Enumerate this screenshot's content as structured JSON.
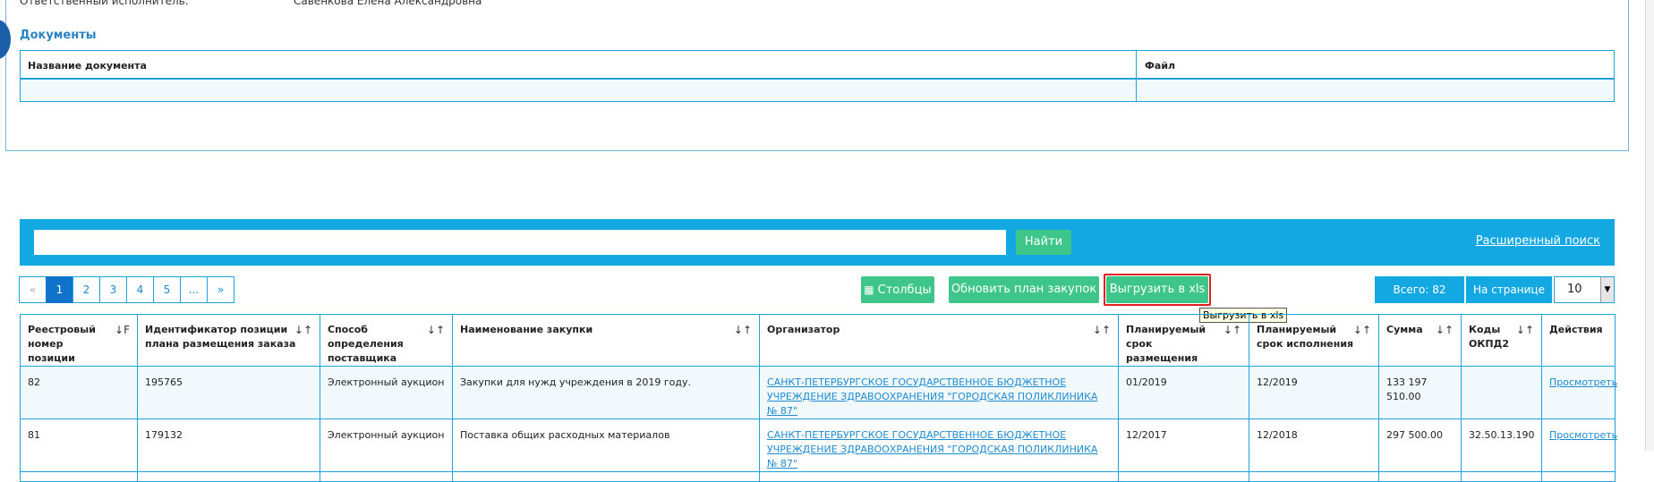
{
  "responsible": {
    "label": "Ответственный исполнитель:",
    "value": "Савенкова Елена Александровна"
  },
  "documents": {
    "title": "Документы",
    "columns": [
      "Название документа",
      "Файл"
    ]
  },
  "search": {
    "placeholder": "",
    "find_label": "Найти",
    "advanced_label": "Расширенный поиск"
  },
  "pagination": {
    "prev": "«",
    "pages": [
      "1",
      "2",
      "3",
      "4",
      "5",
      "..."
    ],
    "next": "»",
    "active": "1"
  },
  "toolbar": {
    "columns_label": "Столбцы",
    "update_label": "Обновить план закупок",
    "export_label": "Выгрузить в xls",
    "export_tooltip": "Выгрузить в xls",
    "total_label": "Всего: 82",
    "per_page_label": "На странице",
    "per_page_value": "10"
  },
  "table": {
    "columns": [
      "Реестровый номер позиции",
      "Идентификатор позиции плана размещения заказа",
      "Способ определения поставщика",
      "Наименование закупки",
      "Организатор",
      "Планируемый срок размещения",
      "Планируемый срок исполнения",
      "Сумма",
      "Коды ОКПД2",
      "Действия"
    ],
    "rows": [
      {
        "reg_num": "82",
        "plan_id": "195765",
        "method": "Электронный аукцион",
        "name": "Закупки для нужд учреждения в 2019 году.",
        "organizer": "САНКТ-ПЕТЕРБУРГСКОЕ ГОСУДАРСТВЕННОЕ БЮДЖЕТНОЕ УЧРЕЖДЕНИЕ ЗДРАВООХРАНЕНИЯ \"ГОРОДСКАЯ ПОЛИКЛИНИКА № 87\"",
        "placement": "01/2019",
        "execution": "12/2019",
        "sum": "133 197 510.00",
        "okpd": "",
        "action": "Просмотреть"
      },
      {
        "reg_num": "81",
        "plan_id": "179132",
        "method": "Электронный аукцион",
        "name": "Поставка общих расходных материалов",
        "organizer": "САНКТ-ПЕТЕРБУРГСКОЕ ГОСУДАРСТВЕННОЕ БЮДЖЕТНОЕ УЧРЕЖДЕНИЕ ЗДРАВООХРАНЕНИЯ \"ГОРОДСКАЯ ПОЛИКЛИНИКА № 87\"",
        "placement": "12/2017",
        "execution": "12/2018",
        "sum": "297 500.00",
        "okpd": "32.50.13.190",
        "action": "Просмотреть"
      }
    ]
  },
  "colors": {
    "accent": "#14a8e3",
    "button_green": "#3ec58a",
    "highlight_red": "#e02020",
    "link": "#1e8bd2"
  }
}
